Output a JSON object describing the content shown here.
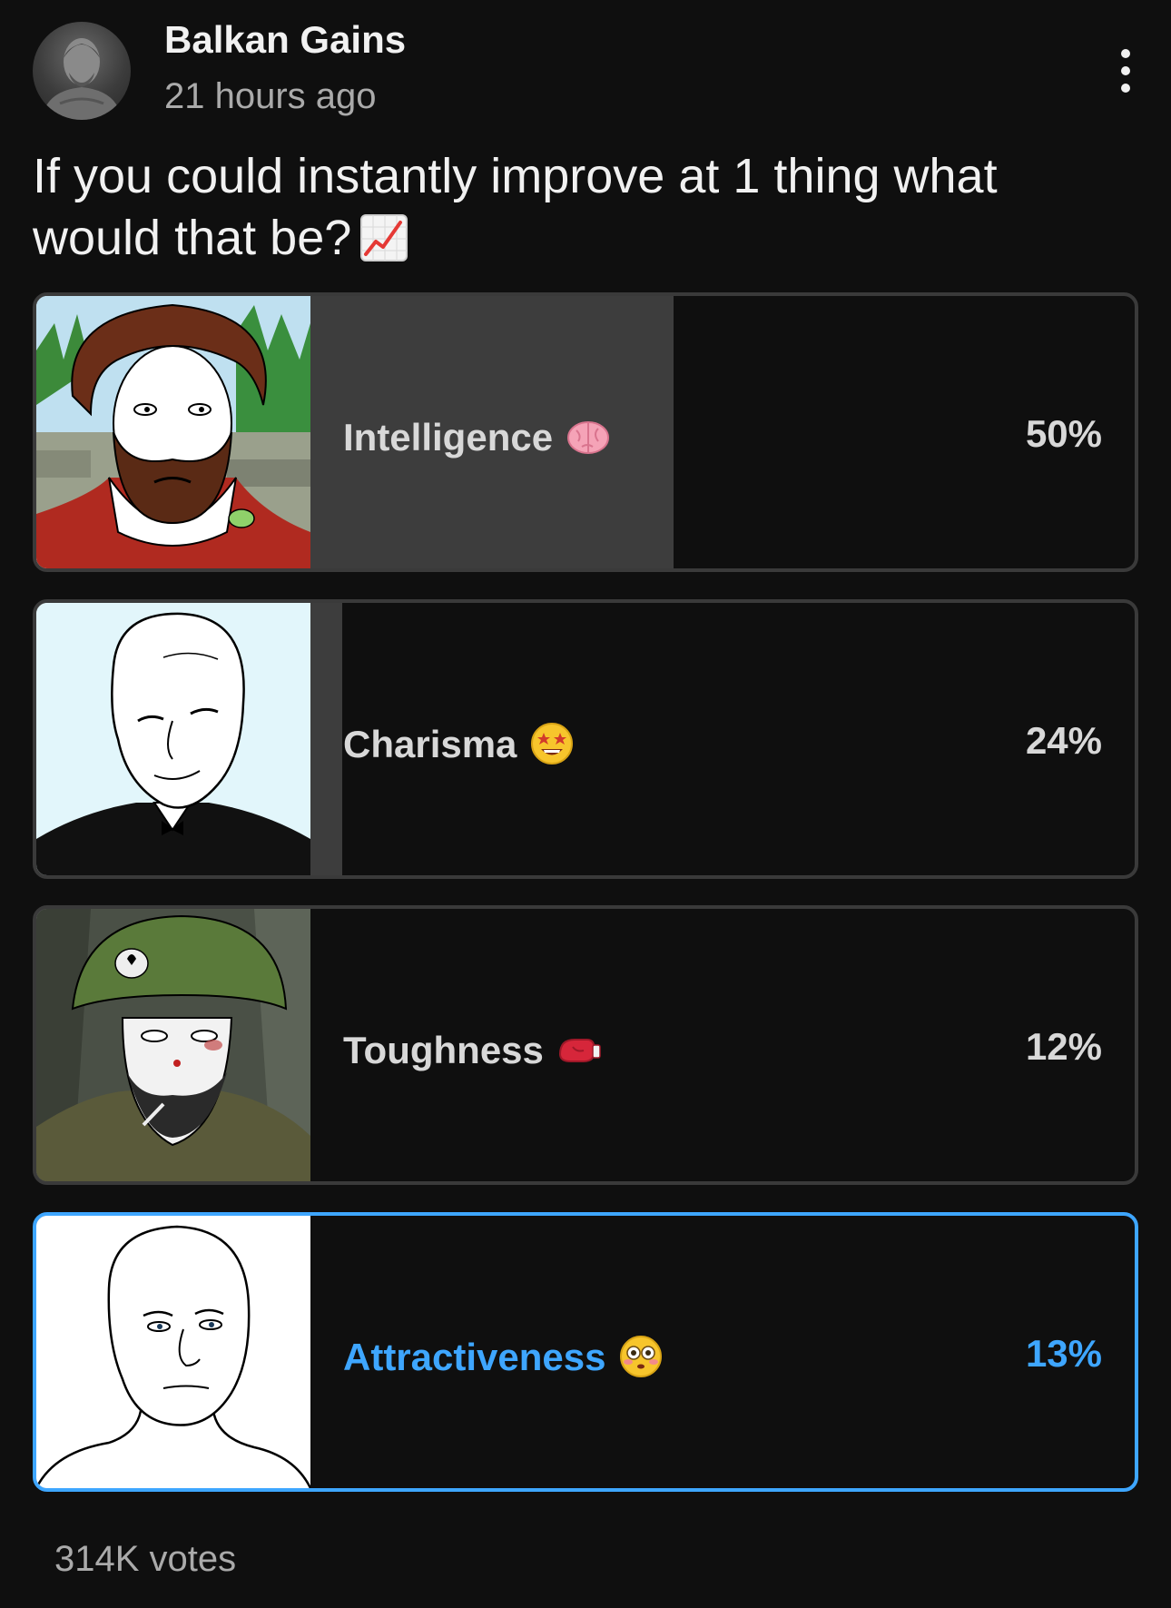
{
  "post": {
    "author": "Balkan Gains",
    "time": "21 hours ago",
    "question": "If you could instantly improve at 1 thing what would that be?",
    "question_icon": "chart-increasing-icon"
  },
  "poll": {
    "options": [
      {
        "label": "Intelligence",
        "emoji": "brain-icon",
        "percent_text": "50%",
        "percent": 50,
        "image": "bearded-philosopher-wojak",
        "selected": false
      },
      {
        "label": "Charisma",
        "emoji": "star-struck-icon",
        "percent_text": "24%",
        "percent": 24,
        "image": "tuxedo-wojak",
        "selected": false
      },
      {
        "label": "Toughness",
        "emoji": "boxing-glove-icon",
        "percent_text": "12%",
        "percent": 12,
        "image": "soldier-wojak",
        "selected": false
      },
      {
        "label": "Attractiveness",
        "emoji": "flushed-face-icon",
        "percent_text": "13%",
        "percent": 13,
        "image": "plain-wojak",
        "selected": true
      }
    ],
    "votes": "314K votes"
  },
  "colors": {
    "background": "#0f0f0f",
    "selected_accent": "#3ea6ff",
    "fill": "#3d3d3d",
    "selected_fill": "#263047"
  }
}
